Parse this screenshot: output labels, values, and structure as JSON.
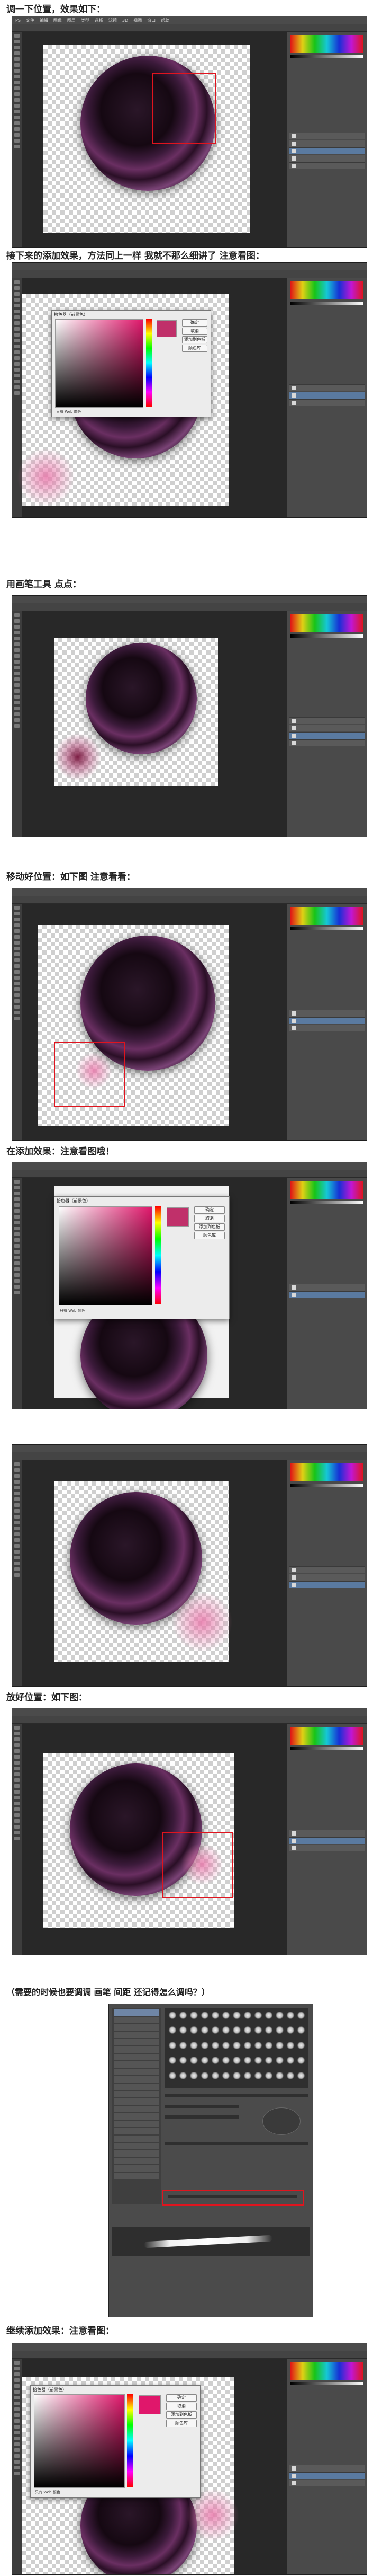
{
  "captions": {
    "c1": "调一下位置，效果如下：",
    "c2": "接下来的添加效果，方法同上一样   我就不那么细讲了    注意看图：",
    "c3": "用画笔工具   点点：",
    "c4": "移动好位置：如下图  注意看看：",
    "c5": "在添加效果：注意看图哦！",
    "c6": "放好位置：如下图：",
    "c7": "（需要的时候也要调调 画笔  间距 还记得怎么调吗？）",
    "c8": "继续添加效果：注意看图："
  },
  "menu": [
    "PS",
    "文件",
    "编辑",
    "图像",
    "图层",
    "类型",
    "选择",
    "滤镜",
    "3D",
    "视图",
    "窗口",
    "帮助"
  ],
  "dialog": {
    "title": "拾色器（前景色）",
    "ok": "确定",
    "cancel": "取消",
    "add_swatch": "添加到色板",
    "color_lib": "颜色库",
    "web_only": "只有 Web 颜色"
  },
  "colors": {
    "accent_red": "#e0141e",
    "glow_pink": "#e878aa",
    "picked_magenta": "#c0306a",
    "panel_bg": "#4a4a4a"
  },
  "icons": [
    "lens-image",
    "color-swatch",
    "brush-tip"
  ]
}
